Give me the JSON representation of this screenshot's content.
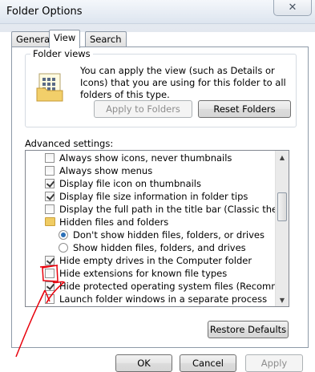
{
  "window": {
    "title": "Folder Options",
    "close_glyph": "✕"
  },
  "tabs": [
    {
      "label": "General",
      "active": false
    },
    {
      "label": "View",
      "active": true
    },
    {
      "label": "Search",
      "active": false
    }
  ],
  "folder_views": {
    "legend": "Folder views",
    "description": "You can apply the view (such as Details or Icons) that you are using for this folder to all folders of this type.",
    "apply_label": "Apply to Folders",
    "reset_label": "Reset Folders",
    "icon": "folder-view-icon"
  },
  "advanced": {
    "label": "Advanced settings:",
    "items": [
      {
        "type": "checkbox",
        "checked": false,
        "label": "Always show icons, never thumbnails"
      },
      {
        "type": "checkbox",
        "checked": false,
        "label": "Always show menus"
      },
      {
        "type": "checkbox",
        "checked": true,
        "label": "Display file icon on thumbnails"
      },
      {
        "type": "checkbox",
        "checked": true,
        "label": "Display file size information in folder tips"
      },
      {
        "type": "checkbox",
        "checked": false,
        "label": "Display the full path in the title bar (Classic theme only)"
      },
      {
        "type": "folder",
        "label": "Hidden files and folders"
      },
      {
        "type": "radio",
        "selected": true,
        "label": "Don't show hidden files, folders, or drives"
      },
      {
        "type": "radio",
        "selected": false,
        "label": "Show hidden files, folders, and drives"
      },
      {
        "type": "checkbox",
        "checked": true,
        "label": "Hide empty drives in the Computer folder"
      },
      {
        "type": "checkbox",
        "checked": false,
        "label": "Hide extensions for known file types"
      },
      {
        "type": "checkbox",
        "checked": true,
        "label": "Hide protected operating system files (Recommended)"
      },
      {
        "type": "checkbox",
        "checked": false,
        "label": "Launch folder windows in a separate process"
      }
    ],
    "restore_label": "Restore Defaults"
  },
  "buttons": {
    "ok": "OK",
    "cancel": "Cancel",
    "apply": "Apply"
  },
  "annotation_color": "#e8000b"
}
